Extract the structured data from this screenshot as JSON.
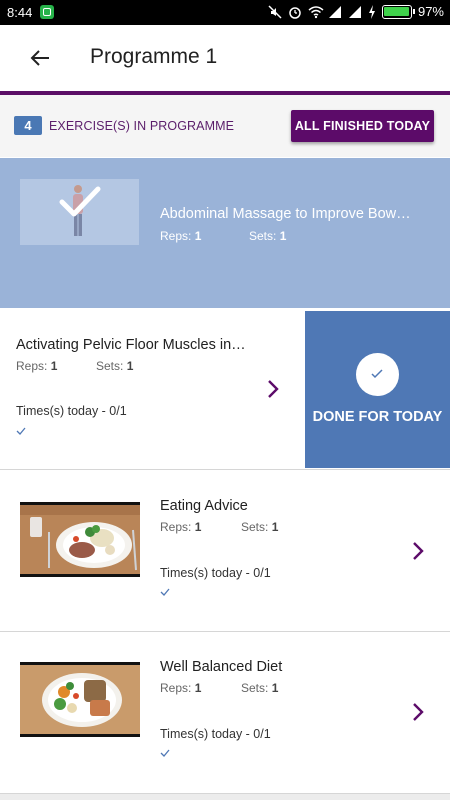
{
  "status_bar": {
    "time": "8:44",
    "battery": "97%"
  },
  "app_bar": {
    "title": "Programme 1",
    "back_icon": "arrow-left-icon"
  },
  "header": {
    "count": "4",
    "count_label": "EXERCISE(S) IN PROGRAMME",
    "finish_button": "ALL FINISHED TODAY"
  },
  "labels": {
    "reps": "Reps:",
    "sets": "Sets:"
  },
  "exercises": [
    {
      "title": "Abdominal Massage to Improve Bow…",
      "reps": "1",
      "sets": "1",
      "completed": true
    },
    {
      "title": "Activating Pelvic Floor Muscles in…",
      "reps": "1",
      "sets": "1",
      "times_today": "Times(s) today - 0/1"
    },
    {
      "title": "Eating Advice",
      "reps": "1",
      "sets": "1",
      "times_today": "Times(s) today - 0/1"
    },
    {
      "title": "Well Balanced Diet",
      "reps": "1",
      "sets": "1",
      "times_today": "Times(s) today - 0/1"
    }
  ],
  "swipe_action": {
    "label": "DONE FOR TODAY",
    "icon": "check-icon"
  },
  "colors": {
    "primary": "#5c0b69",
    "accent_blue": "#4f78b5",
    "completed_bg": "#9ab3d8",
    "badge": "#4a78b4"
  }
}
